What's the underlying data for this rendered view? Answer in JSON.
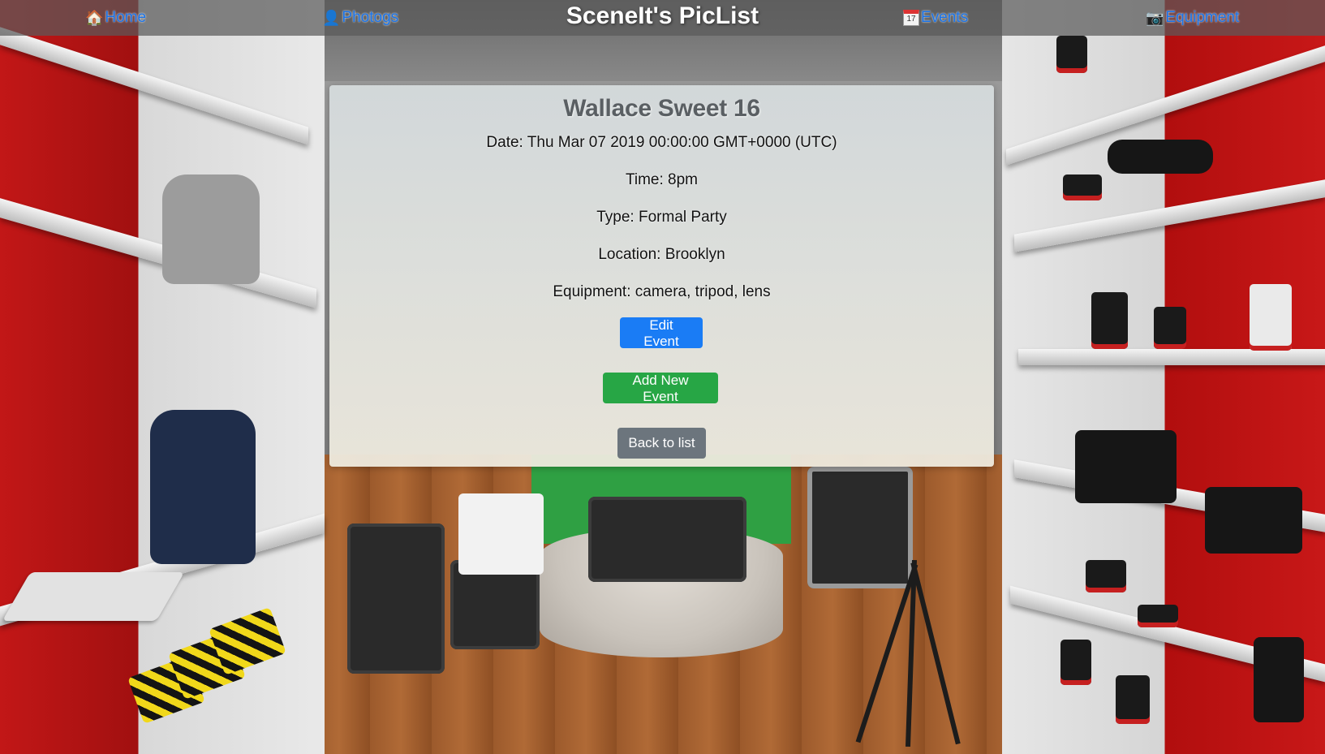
{
  "nav": {
    "brand": "SceneIt's PicList",
    "links": [
      {
        "label": "Home",
        "icon": "house-icon"
      },
      {
        "label": "Photogs",
        "icon": "person-icon"
      },
      {
        "label": "Events",
        "icon": "calendar-icon"
      },
      {
        "label": "Equipment",
        "icon": "camera-icon"
      }
    ],
    "calendar_day": "17"
  },
  "event": {
    "title": "Wallace Sweet 16",
    "date_label": "Date:",
    "date": "Thu Mar 07 2019 00:00:00 GMT+0000 (UTC)",
    "time_label": "Time:",
    "time": "8pm",
    "type_label": "Type:",
    "type": "Formal Party",
    "location_label": "Location:",
    "location": "Brooklyn",
    "equipment_label": "Equipment:",
    "equipment": "camera, tripod, lens"
  },
  "buttons": {
    "edit": "Edit Event",
    "add": "Add New Event",
    "back": "Back to list"
  },
  "colors": {
    "link": "#1a73e8",
    "edit_button": "#1a7cf5",
    "add_button": "#27a645",
    "back_button": "#6c757d"
  }
}
